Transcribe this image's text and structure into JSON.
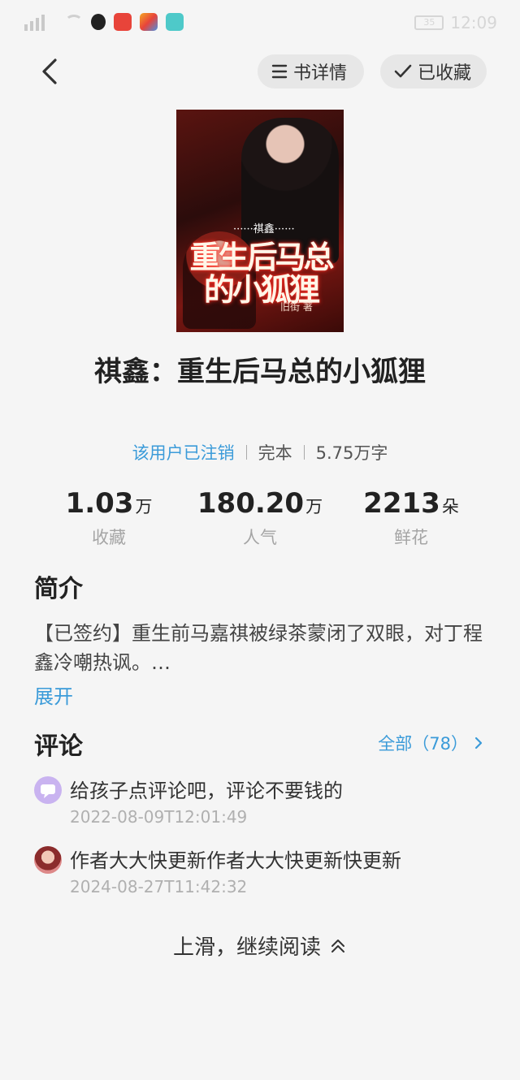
{
  "status_bar": {
    "right_text": "12:09",
    "battery": "35"
  },
  "nav": {
    "detail_label": "书详情",
    "fav_label": "已收藏"
  },
  "cover": {
    "tag_text": "······祺鑫······",
    "title_line1": "重生后马总",
    "title_line2": "的小狐狸",
    "author_text": "旧街 著"
  },
  "book": {
    "title": "祺鑫：重生后马总的小狐狸",
    "author": "该用户已注销",
    "status": "完本",
    "word_count": "5.75万字"
  },
  "stats": [
    {
      "num": "1.03",
      "unit": "万",
      "label": "收藏"
    },
    {
      "num": "180.20",
      "unit": "万",
      "label": "人气"
    },
    {
      "num": "2213",
      "unit": "朵",
      "label": "鲜花"
    }
  ],
  "intro": {
    "heading": "简介",
    "text": "【已签约】重生前马嘉祺被绿茶蒙闭了双眼，对丁程鑫冷嘲热讽。…",
    "expand_label": "展开"
  },
  "comments": {
    "heading": "评论",
    "all_label": "全部（78）",
    "items": [
      {
        "text": "给孩子点评论吧，评论不要钱的",
        "time": "2022-08-09T12:01:49",
        "avatar_color": "#c9b3f0"
      },
      {
        "text": "作者大大快更新作者大大快更新快更新",
        "time": "2024-08-27T11:42:32",
        "avatar_color": "#b04a4a"
      }
    ]
  },
  "continue_label": "上滑，继续阅读",
  "colors": {
    "accent": "#3b9bd9",
    "background": "#f5f5f5"
  }
}
